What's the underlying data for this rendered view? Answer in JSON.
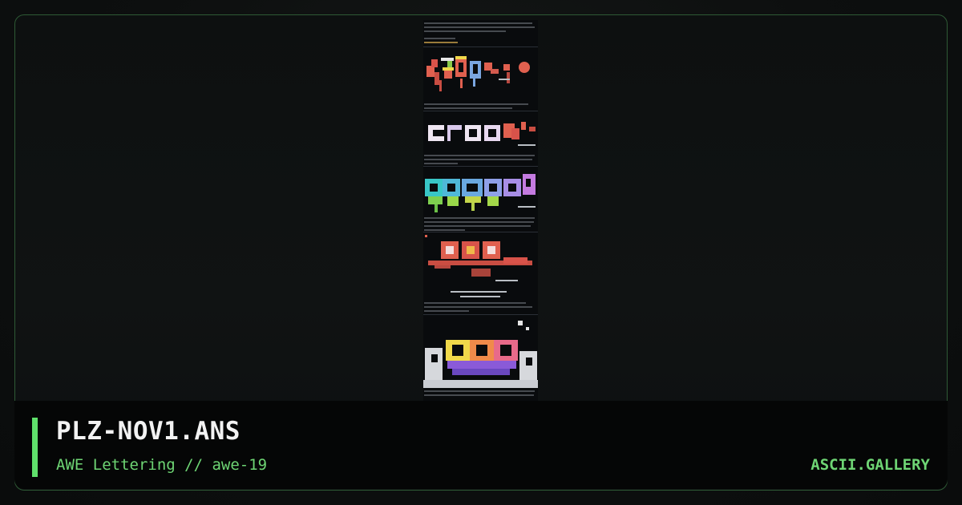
{
  "card": {
    "title": "PLZ-NOV1.ANS",
    "subtitle": "AWE Lettering // awe-19",
    "brand": "ASCII.GALLERY",
    "colors": {
      "accent": "#5fe06b",
      "frame_border": "#2e5a35",
      "background": "#0c0e0e",
      "bottom_bar": "#050606"
    }
  },
  "preview": {
    "icon": "ansi-art-thumbnail",
    "logos": [
      "zoo",
      "croo",
      "combo",
      "ooo",
      "awe"
    ]
  }
}
